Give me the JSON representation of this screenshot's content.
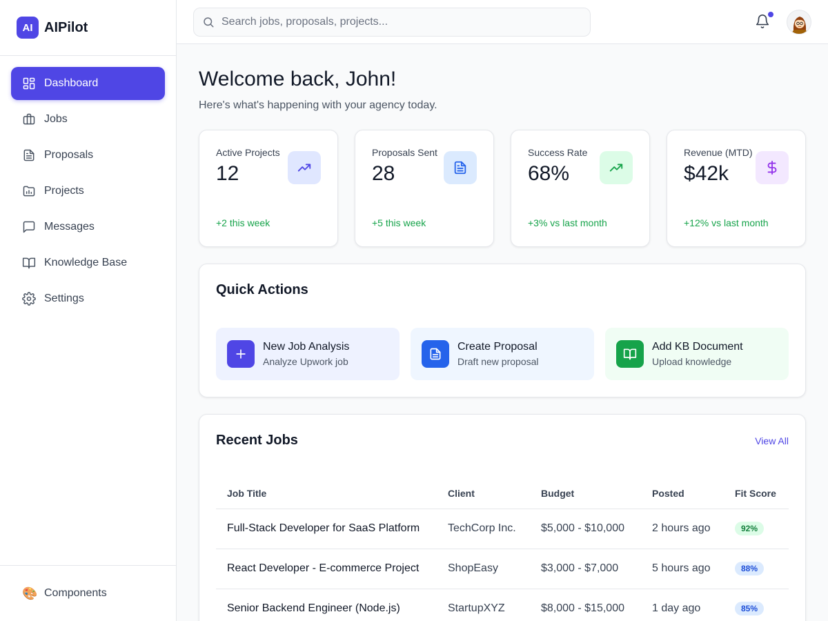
{
  "brand": {
    "logo": "AI",
    "name": "AIPilot",
    "accent": "#4f46e5"
  },
  "sidebar": {
    "items": [
      {
        "label": "Dashboard",
        "icon": "dashboard-grid-icon",
        "active": true
      },
      {
        "label": "Jobs",
        "icon": "briefcase-icon"
      },
      {
        "label": "Proposals",
        "icon": "document-icon"
      },
      {
        "label": "Projects",
        "icon": "folder-icon"
      },
      {
        "label": "Messages",
        "icon": "message-icon"
      },
      {
        "label": "Knowledge Base",
        "icon": "book-icon"
      },
      {
        "label": "Settings",
        "icon": "gear-icon"
      }
    ],
    "footer": {
      "label": "Components",
      "icon": "palette-icon"
    }
  },
  "header": {
    "search_placeholder": "Search jobs, proposals, projects...",
    "search_value": "",
    "has_notification": true
  },
  "main": {
    "welcome": "Welcome back, John!",
    "subtitle": "Here's what's happening with your agency today.",
    "stats": [
      {
        "label": "Active Projects",
        "value": "12",
        "delta": "+2 this week",
        "icon": "trending-up-icon",
        "icon_bg": "#e0e7ff",
        "icon_color": "#4f46e5"
      },
      {
        "label": "Proposals Sent",
        "value": "28",
        "delta": "+5 this week",
        "icon": "document-icon",
        "icon_bg": "#dbeafe",
        "icon_color": "#2563eb"
      },
      {
        "label": "Success Rate",
        "value": "68%",
        "delta": "+3% vs last month",
        "icon": "trending-up-icon",
        "icon_bg": "#dcfce7",
        "icon_color": "#16a34a"
      },
      {
        "label": "Revenue (MTD)",
        "value": "$42k",
        "delta": "+12% vs last month",
        "icon": "dollar-icon",
        "icon_bg": "#f3e8ff",
        "icon_color": "#9333ea"
      }
    ],
    "quick_actions": {
      "title": "Quick Actions",
      "items": [
        {
          "title": "New Job Analysis",
          "subtitle": "Analyze Upwork job",
          "icon": "plus-icon",
          "bg": "#eef2ff",
          "icon_bg": "#4f46e5"
        },
        {
          "title": "Create Proposal",
          "subtitle": "Draft new proposal",
          "icon": "document-icon",
          "bg": "#eff6ff",
          "icon_bg": "#2563eb"
        },
        {
          "title": "Add KB Document",
          "subtitle": "Upload knowledge",
          "icon": "book-icon",
          "bg": "#f0fdf4",
          "icon_bg": "#16a34a"
        }
      ]
    },
    "recent_jobs": {
      "title": "Recent Jobs",
      "view_all": "View All",
      "columns": [
        "Job Title",
        "Client",
        "Budget",
        "Posted",
        "Fit Score"
      ],
      "rows": [
        {
          "title": "Full-Stack Developer for SaaS Platform",
          "client": "TechCorp Inc.",
          "budget": "$5,000 - $10,000",
          "posted": "2 hours ago",
          "fit": "92%",
          "fit_bg": "#dcfce7",
          "fit_color": "#15803d"
        },
        {
          "title": "React Developer - E-commerce Project",
          "client": "ShopEasy",
          "budget": "$3,000 - $7,000",
          "posted": "5 hours ago",
          "fit": "88%",
          "fit_bg": "#dbeafe",
          "fit_color": "#1d4ed8"
        },
        {
          "title": "Senior Backend Engineer (Node.js)",
          "client": "StartupXYZ",
          "budget": "$8,000 - $15,000",
          "posted": "1 day ago",
          "fit": "85%",
          "fit_bg": "#dbeafe",
          "fit_color": "#1d4ed8"
        }
      ]
    }
  }
}
